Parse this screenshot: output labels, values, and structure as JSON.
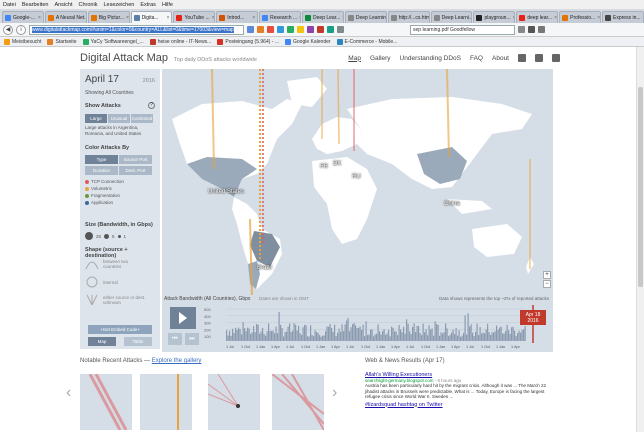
{
  "menu": [
    "Datei",
    "Bearbeiten",
    "Ansicht",
    "Chronik",
    "Lesezeichen",
    "Extras",
    "Hilfe"
  ],
  "tabs": [
    {
      "label": "Google-...",
      "color": "#4285f4",
      "active": false
    },
    {
      "label": "A Neural Net...",
      "color": "#e37400",
      "active": false
    },
    {
      "label": "Big Pictur...",
      "color": "#e37400",
      "active": false
    },
    {
      "label": "Digita...",
      "color": "#5a7fa8",
      "active": true
    },
    {
      "label": "YouTube ...",
      "color": "#e62117",
      "active": false
    },
    {
      "label": "Introd...",
      "color": "#d35400",
      "active": false
    },
    {
      "label": "Research ...",
      "color": "#4285f4",
      "active": false
    },
    {
      "label": "Deep Lear...",
      "color": "#0a8a3a",
      "active": false
    },
    {
      "label": "Deep Learning",
      "color": "#888",
      "active": false
    },
    {
      "label": "http://...cs.html",
      "color": "#888",
      "active": false
    },
    {
      "label": "Deep Learni...",
      "color": "#888",
      "active": false
    },
    {
      "label": "playgroun...",
      "color": "#222",
      "active": false
    },
    {
      "label": "deep lear...",
      "color": "#e62117",
      "active": false
    },
    {
      "label": "Professio...",
      "color": "#e37400",
      "active": false
    },
    {
      "label": "Express in...",
      "color": "#444",
      "active": false
    }
  ],
  "url": "www.digitalattackmap.com/#anim=1&color=0&country=ALL&list=0&time=17003&view=map",
  "search": "sep learning.pdf Goodfellow",
  "bookmarks": [
    "Meistbesucht",
    "Startseite",
    "YaCy 'Softwareengel_...",
    "heise online - IT-News...",
    "Posteingang (5.964) - ...",
    "Google Kalender",
    "E-Commerce - Mobile..."
  ],
  "site": {
    "logo": "Digital Attack Map",
    "tagline": "Top daily DDoS attacks worldwide",
    "nav": [
      "Map",
      "Gallery",
      "Understanding DDoS",
      "FAQ",
      "About"
    ]
  },
  "panel": {
    "date": "April 17",
    "year": "2016",
    "showing": "Showing All Countries",
    "show_attacks": "Show Attacks",
    "attack_buttons": [
      "Large",
      "Unusual",
      "Combined"
    ],
    "large_note": "Large attacks in Argentina, Romania, and United States",
    "color_by": "Color Attacks By",
    "color_buttons": [
      "Type",
      "Source Port",
      "Duration",
      "Dest. Port"
    ],
    "legend": [
      {
        "label": "TCP Connection",
        "color": "#e05a5a"
      },
      {
        "label": "Volumetric",
        "color": "#e8a33a"
      },
      {
        "label": "Fragmentation",
        "color": "#6a9a3a"
      },
      {
        "label": "Application",
        "color": "#3a6a9a"
      }
    ],
    "size_title": "Size (Bandwidth, in Gbps)",
    "size_vals": [
      "25",
      "5",
      "1"
    ],
    "shape_title": "Shape (source + destination)",
    "shapes": [
      "between two countries",
      "internal",
      "either source or dest. unknown"
    ],
    "embed": "+Get Embed Code+",
    "map_btn": "Map",
    "table_btn": "Table"
  },
  "map_labels": [
    {
      "text": "United States",
      "left": 46,
      "top": 120
    },
    {
      "text": "China",
      "left": 282,
      "top": 132
    },
    {
      "text": "Brazil",
      "left": 95,
      "top": 196
    },
    {
      "text": "FR",
      "left": 158,
      "top": 95
    },
    {
      "text": "DK",
      "left": 171,
      "top": 92
    },
    {
      "text": "RU",
      "left": 190,
      "top": 105
    },
    {
      "text": "AR",
      "left": 86,
      "top": 229
    },
    {
      "text": "NZ",
      "left": 364,
      "top": 234
    }
  ],
  "timeline": {
    "title": "Attack Bandwidth (All Countries), Gbps",
    "units": "Dates are shown in GMT",
    "note": "Data shows represents the top ~2% of reported attacks",
    "yticks": [
      "500",
      "400",
      "300",
      "200",
      "100"
    ],
    "xticks": [
      "1 Jul",
      "1 Oct",
      "1 Jan",
      "1 Apr",
      "1 Jul",
      "1 Oct",
      "1 Jan",
      "1 Apr",
      "1 Jul",
      "1 Oct",
      "1 Jan",
      "1 Apr",
      "1 Jul",
      "1 Oct",
      "1 Jan",
      "1 Apr",
      "1 Jul",
      "1 Oct",
      "1 Jan",
      "1 Apr"
    ],
    "badge_date": "Apr 18",
    "badge_year": "2016"
  },
  "notable": {
    "label": "Notable Recent Attacks",
    "link": "Explore the gallery"
  },
  "webnews": "Web & News Results (Apr 17)",
  "news": [
    {
      "title": "Allah's Willing Executioners",
      "source": "searchlight-germany.blogspot.com",
      "time": " - 6 hours ago",
      "body": "Austria has been particularly hard hit by the migrant crisis. Although it was ... The March 22 jihadist attacks in Brussels were predictable. What is ... Today, Europe is facing the largest refugee crisis since World War II. Sweden ..."
    },
    {
      "title": "#lizardsquad hashtag on Twitter",
      "source": "",
      "time": "",
      "body": ""
    }
  ]
}
